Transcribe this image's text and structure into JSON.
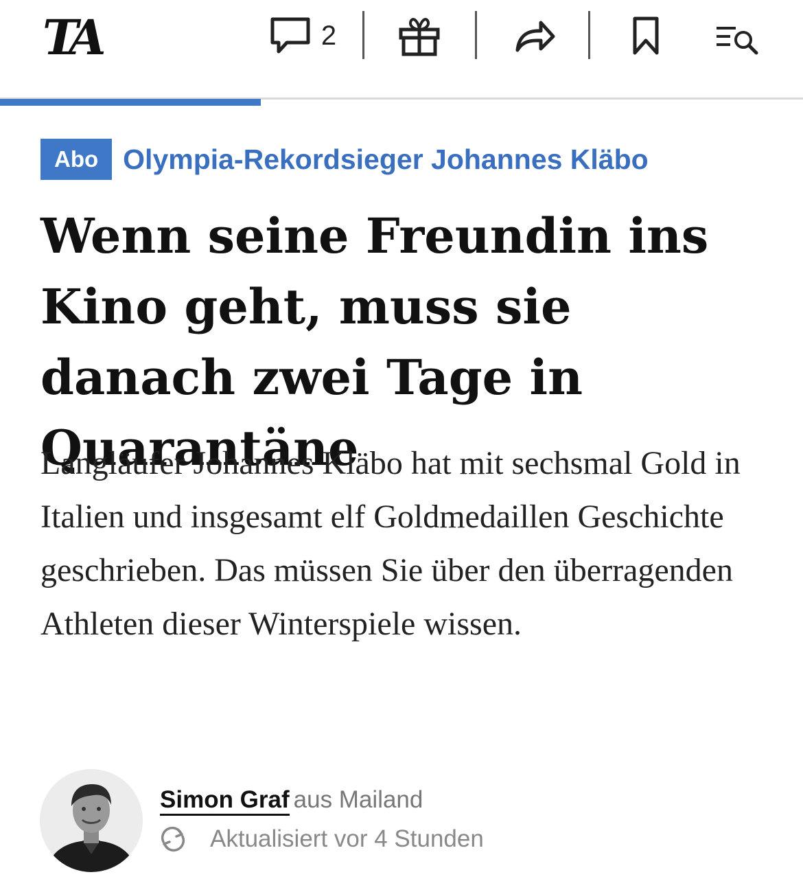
{
  "header": {
    "logo_text": "TA",
    "comment_count": "2",
    "icons": {
      "comments": "comment-icon",
      "gift": "gift-icon",
      "share": "share-icon",
      "bookmark": "bookmark-icon",
      "menu": "menu-search-icon"
    },
    "reading_progress": 0.325,
    "accent_color": "#3f78c6"
  },
  "article": {
    "badge": "Abo",
    "kicker": "Olympia-Rekordsieger Johannes Kläbo",
    "headline": "Wenn seine Freundin ins Kino geht, muss sie danach zwei Tage in Quarantäne",
    "lead": "Langläufer Johannes Kläbo hat mit sechsmal Gold in Italien und insgesamt elf Goldmedaillen Geschichte geschrieben. Das müssen Sie über den überragenden Athleten dieser Winterspiele wissen."
  },
  "byline": {
    "author": "Simon Graf",
    "location": "aus Mailand",
    "updated": "Aktualisiert vor 4 Stunden",
    "updated_icon": "refresh-icon",
    "avatar": "author-photo"
  }
}
